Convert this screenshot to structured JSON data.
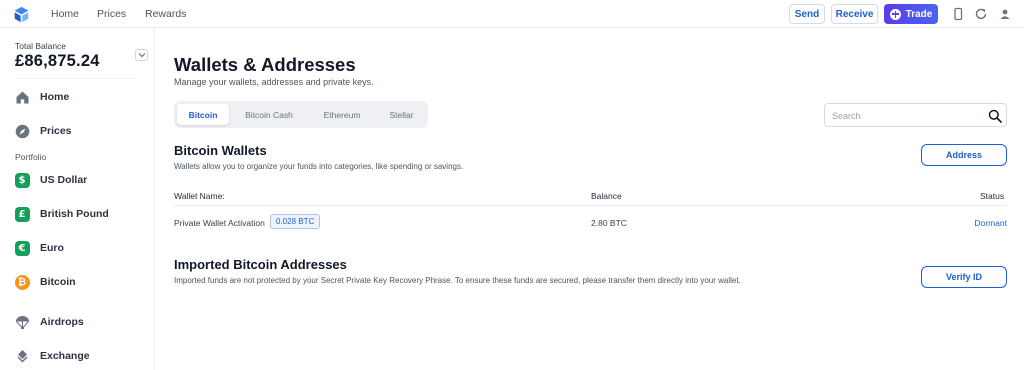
{
  "topnav": {
    "links": [
      "Home",
      "Prices",
      "Rewards"
    ],
    "send_label": "Send",
    "receive_label": "Receive",
    "trade_label": "Trade"
  },
  "sidebar": {
    "balance_label": "Total Balance",
    "balance_value": "£86,875.24",
    "items": [
      {
        "label": "Home",
        "icon": "home-icon"
      },
      {
        "label": "Prices",
        "icon": "compass-icon"
      }
    ],
    "portfolio_label": "Portfolio",
    "portfolio_items": [
      {
        "label": "US Dollar",
        "symbol": "$",
        "color": "#12a05a"
      },
      {
        "label": "British Pound",
        "symbol": "£",
        "color": "#12a05a"
      },
      {
        "label": "Euro",
        "symbol": "€",
        "color": "#12a05a"
      },
      {
        "label": "Bitcoin",
        "symbol": "₿",
        "color": "#f7931a"
      }
    ],
    "extra_items": [
      {
        "label": "Airdrops",
        "icon": "parachute-icon"
      },
      {
        "label": "Exchange",
        "icon": "exchange-icon"
      }
    ]
  },
  "main": {
    "title": "Wallets & Addresses",
    "subtitle": "Manage your wallets, addresses and private keys.",
    "tabs": [
      "Bitcoin",
      "Bitcoin Cash",
      "Ethereum",
      "Stellar"
    ],
    "active_tab": "Bitcoin",
    "search_placeholder": "Search",
    "wallets": {
      "title": "Bitcoin Wallets",
      "description": "Wallets allow you to organize your funds into categories, like spending or savings.",
      "button_label": "Address",
      "columns": [
        "Wallet Name:",
        "Balance",
        "Status"
      ],
      "rows": [
        {
          "name": "Private Wallet Activation",
          "badge": "0.028 BTC",
          "balance": "2.80 BTC",
          "status": "Dormant"
        }
      ]
    },
    "imported": {
      "title": "Imported Bitcoin Addresses",
      "description": "Imported funds are not protected by your Secret Private Key Recovery Phrase. To ensure these funds are secured, please transfer them directly into your wallet.",
      "button_label": "Verify ID"
    }
  },
  "colors": {
    "accent": "#1f5fd1",
    "trade_gradient": [
      "#5a3ee8",
      "#4a63f0"
    ],
    "fiat_green": "#12a05a",
    "bitcoin_orange": "#f7931a"
  }
}
